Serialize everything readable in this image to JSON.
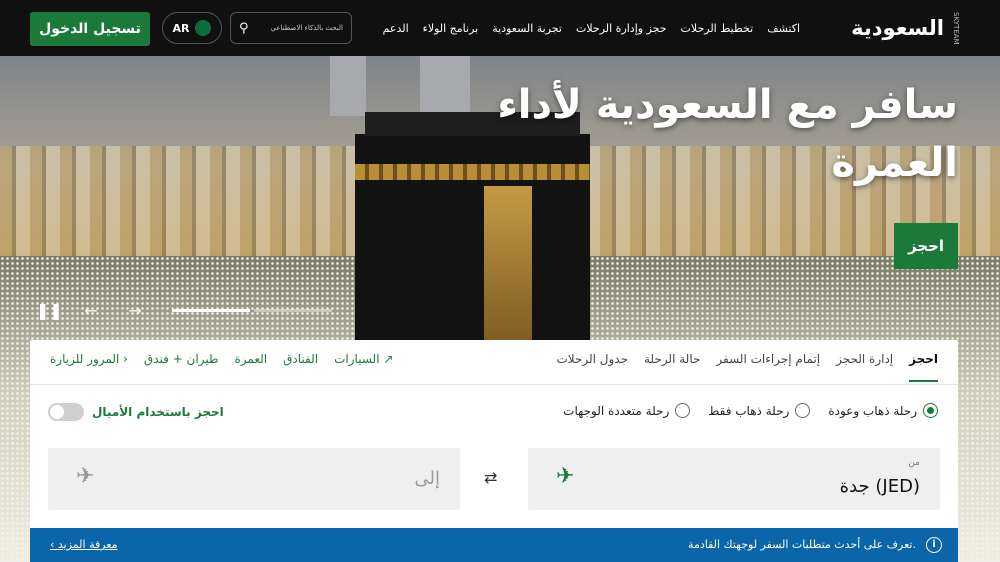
{
  "header": {
    "logo_text": "السعودية",
    "logo_sub": "SKYTEAM",
    "nav": [
      "اكتشف",
      "تخطيط الرحلات",
      "حجز وإدارة الرحلات",
      "تجربة السعودية",
      "برنامج الولاء",
      "الدعم"
    ],
    "search_placeholder": "البحث بالذكاء الاصطناعي",
    "language": "AR",
    "login_label": "تسجيل الدخول"
  },
  "hero": {
    "title": "سافر مع السعودية لأداء العمرة",
    "book_label": "احجز",
    "controls": {
      "pause": "❚❚",
      "prev": "←",
      "next": "→"
    },
    "progress_active_index": 0,
    "progress_count": 2
  },
  "booking": {
    "tabs": [
      "احجز",
      "إدارة الحجز",
      "إتمام إجراءات السفر",
      "حالة الرحلة",
      "جدول الرحلات"
    ],
    "active_tab": 0,
    "links": [
      "المرور للزيارة ›",
      "طيران + فندق",
      "العمرة",
      "الفنادق",
      "السيارات ↗"
    ],
    "trip_types": [
      {
        "label": "رحلة ذهاب وعودة",
        "selected": true
      },
      {
        "label": "رحلة ذهاب فقط",
        "selected": false
      },
      {
        "label": "رحلة متعددة الوجهات",
        "selected": false
      }
    ],
    "miles_label": "احجز باستخدام الأميال",
    "from_label": "من",
    "from_value": "جدة (JED)",
    "to_placeholder": "إلى",
    "swap_icon": "⇄"
  },
  "info": {
    "text": "تعرف على أحدث متطلبات السفر لوجهتك القادمة.",
    "link": "‹ معرفة المزيد",
    "icon": "i"
  },
  "colors": {
    "brand_green": "#1b7a3a",
    "info_blue": "#0a66a8",
    "header_bg": "#101010"
  }
}
